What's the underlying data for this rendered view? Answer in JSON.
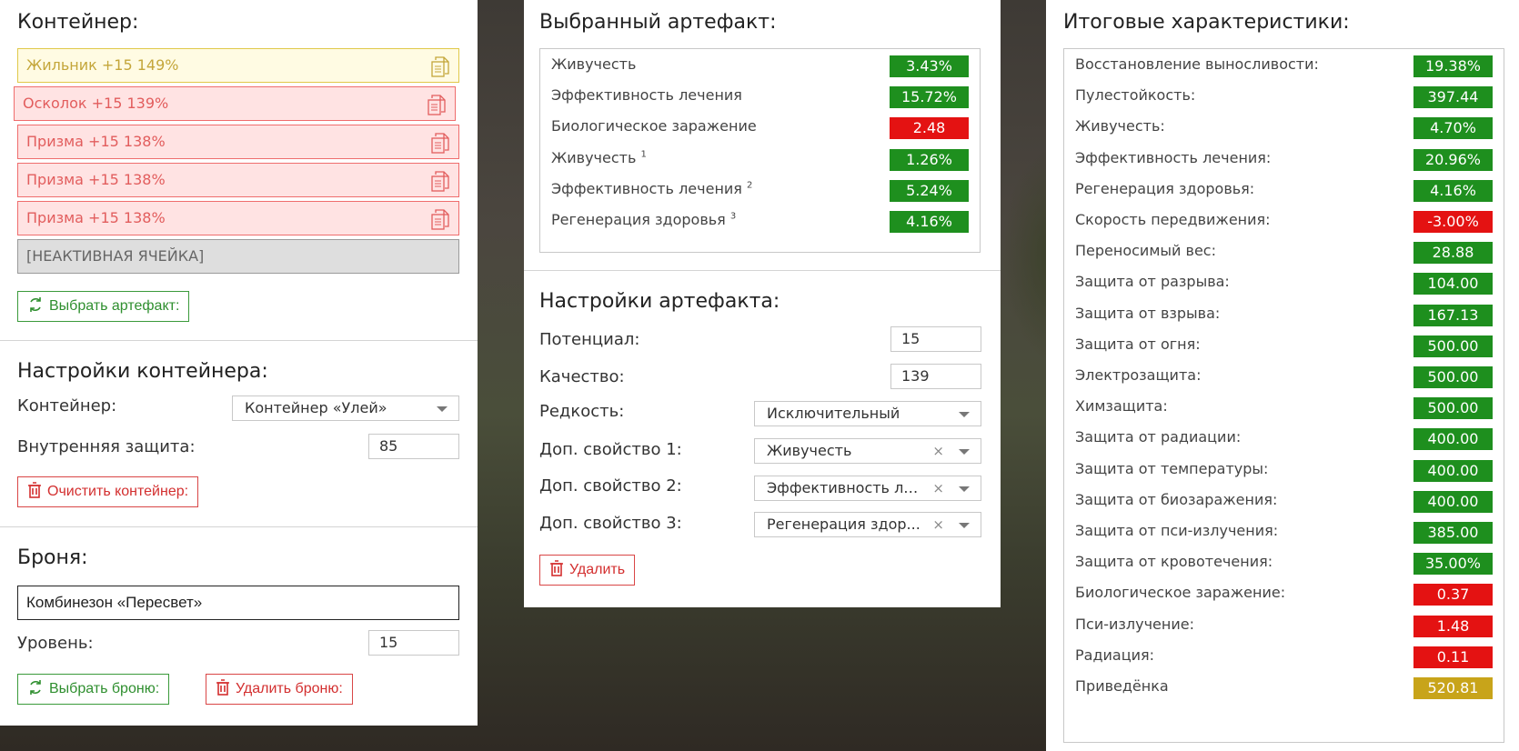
{
  "left": {
    "container_title": "Контейнер:",
    "cells": [
      {
        "label": "Жильник +15 149%",
        "style": "yellow"
      },
      {
        "label": "Осколок +15 139%",
        "style": "red"
      },
      {
        "label": "Призма +15 138%",
        "style": "red"
      },
      {
        "label": "Призма +15 138%",
        "style": "red"
      },
      {
        "label": "Призма +15 138%",
        "style": "red"
      },
      {
        "label": "[НЕАКТИВНАЯ ЯЧЕЙКА]",
        "style": "inactive"
      }
    ],
    "select_artifact_btn": "Выбрать артефакт:",
    "container_settings_title": "Настройки контейнера:",
    "container_label": "Контейнер:",
    "container_value": "Контейнер «Улей»",
    "inner_protection_label": "Внутренняя защита:",
    "inner_protection_value": "85",
    "clear_container_btn": "Очистить контейнер:",
    "armor_title": "Броня:",
    "armor_value": "Комбинезон «Пересвет»",
    "level_label": "Уровень:",
    "level_value": "15",
    "select_armor_btn": "Выбрать броню:",
    "delete_armor_btn": "Удалить броню:"
  },
  "middle": {
    "selected_title": "Выбранный артефакт:",
    "stats": [
      {
        "name": "Живучесть",
        "sup": "",
        "value": "3.43%",
        "color": "green"
      },
      {
        "name": "Эффективность лечения",
        "sup": "",
        "value": "15.72%",
        "color": "green"
      },
      {
        "name": "Биологическое заражение",
        "sup": "",
        "value": "2.48",
        "color": "red"
      },
      {
        "name": "Живучесть",
        "sup": "1",
        "value": "1.26%",
        "color": "green"
      },
      {
        "name": "Эффективность лечения",
        "sup": "2",
        "value": "5.24%",
        "color": "green"
      },
      {
        "name": "Регенерация здоровья",
        "sup": "3",
        "value": "4.16%",
        "color": "green"
      }
    ],
    "settings_title": "Настройки артефакта:",
    "potential_label": "Потенциал:",
    "potential_value": "15",
    "quality_label": "Качество:",
    "quality_value": "139",
    "rarity_label": "Редкость:",
    "rarity_value": "Исключительный",
    "extra1_label": "Доп. свойство 1:",
    "extra1_value": "Живучесть",
    "extra2_label": "Доп. свойство 2:",
    "extra2_value": "Эффективность ле...",
    "extra3_label": "Доп. свойство 3:",
    "extra3_value": "Регенерация здор...",
    "clear_symbol": "×",
    "delete_btn": "Удалить"
  },
  "right": {
    "title": "Итоговые характеристики:",
    "stats": [
      {
        "name": "Восстановление выносливости:",
        "value": "19.38%",
        "color": "green"
      },
      {
        "name": "Пулестойкость:",
        "value": "397.44",
        "color": "green"
      },
      {
        "name": "Живучесть:",
        "value": "4.70%",
        "color": "green"
      },
      {
        "name": "Эффективность лечения:",
        "value": "20.96%",
        "color": "green"
      },
      {
        "name": "Регенерация здоровья:",
        "value": "4.16%",
        "color": "green"
      },
      {
        "name": "Скорость передвижения:",
        "value": "-3.00%",
        "color": "red"
      },
      {
        "name": "Переносимый вес:",
        "value": "28.88",
        "color": "green"
      },
      {
        "name": "Защита от разрыва:",
        "value": "104.00",
        "color": "green"
      },
      {
        "name": "Защита от взрыва:",
        "value": "167.13",
        "color": "green"
      },
      {
        "name": "Защита от огня:",
        "value": "500.00",
        "color": "green"
      },
      {
        "name": "Электрозащита:",
        "value": "500.00",
        "color": "green"
      },
      {
        "name": "Химзащита:",
        "value": "500.00",
        "color": "green"
      },
      {
        "name": "Защита от радиации:",
        "value": "400.00",
        "color": "green"
      },
      {
        "name": "Защита от температуры:",
        "value": "400.00",
        "color": "green"
      },
      {
        "name": "Защита от биозаражения:",
        "value": "400.00",
        "color": "green"
      },
      {
        "name": "Защита от пси-излучения:",
        "value": "385.00",
        "color": "green"
      },
      {
        "name": "Защита от кровотечения:",
        "value": "35.00%",
        "color": "green"
      },
      {
        "name": "Биологическое заражение:",
        "value": "0.37",
        "color": "red"
      },
      {
        "name": "Пси-излучение:",
        "value": "1.48",
        "color": "red"
      },
      {
        "name": "Радиация:",
        "value": "0.11",
        "color": "red"
      },
      {
        "name": "Приведёнка",
        "value": "520.81",
        "color": "gold"
      }
    ]
  },
  "colors": {
    "green": "#1e8f1e",
    "red": "#e41212",
    "gold": "#c8a41a"
  }
}
